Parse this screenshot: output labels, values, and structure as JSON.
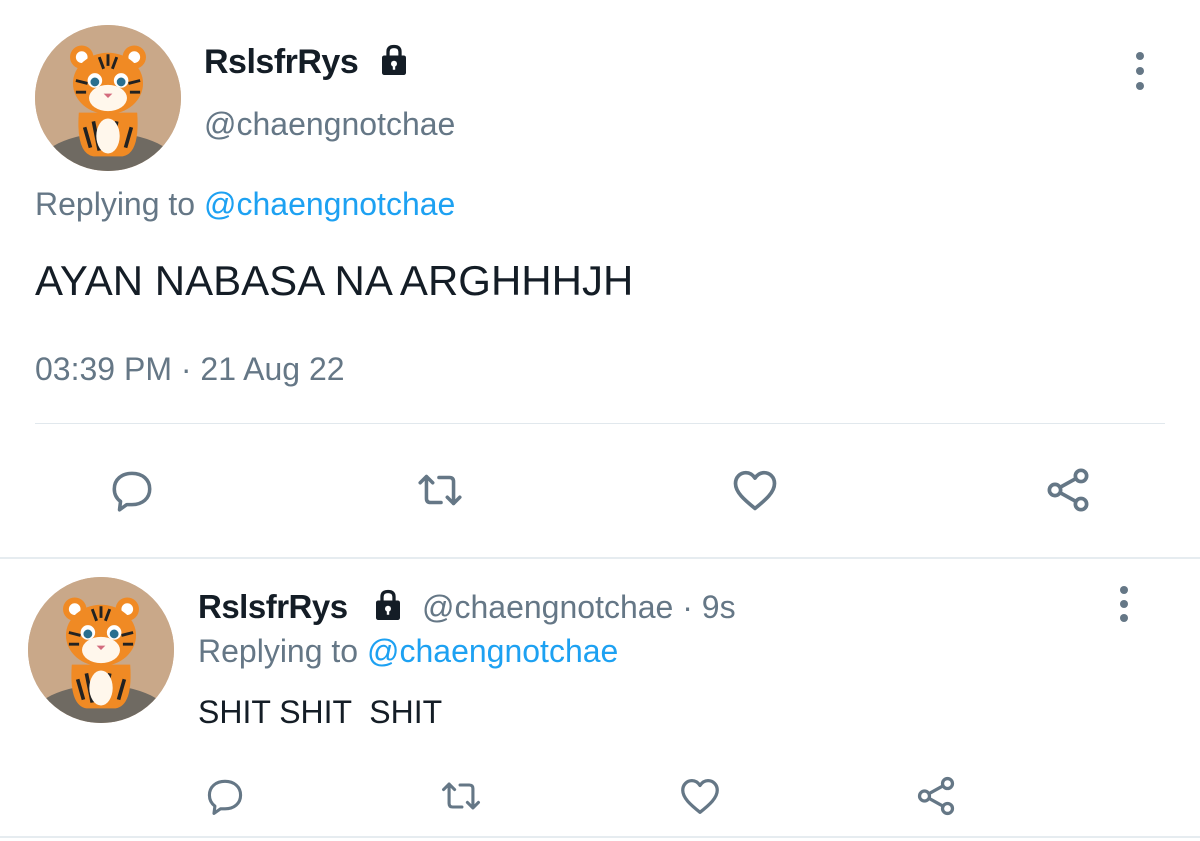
{
  "tweets": [
    {
      "display_name": "RslsfrRys",
      "handle": "@chaengnotchae",
      "replying_label": "Replying to",
      "replying_to": "@chaengnotchae",
      "text": "AYAN NABASA NA ARGHHHJH",
      "timestamp": "03:39 PM · 21 Aug 22",
      "icons": [
        "lock-icon",
        "more-options-icon",
        "reply-icon",
        "retweet-icon",
        "like-icon",
        "share-icon"
      ]
    },
    {
      "display_name": "RslsfrRys",
      "handle": "@chaengnotchae",
      "time_ago": "· 9s",
      "replying_label": "Replying to",
      "replying_to": "@chaengnotchae",
      "text": "SHIT SHIT  SHIT",
      "icons": [
        "lock-icon",
        "more-options-icon",
        "reply-icon",
        "retweet-icon",
        "like-icon",
        "share-icon"
      ]
    }
  ],
  "colors": {
    "text": "#141d26",
    "secondary": "#657786",
    "link": "#1da1f2",
    "divider": "#e1e8ed",
    "avatar_bg": "#c9a889"
  }
}
